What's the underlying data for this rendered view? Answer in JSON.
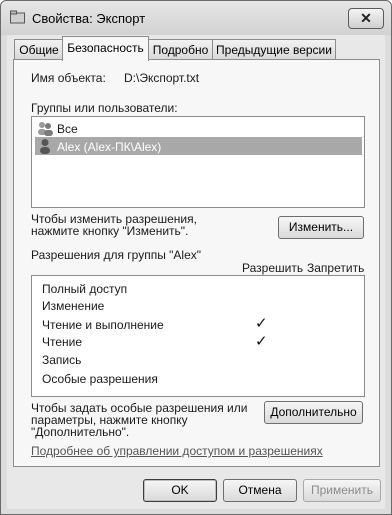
{
  "window": {
    "title": "Свойства: Экспорт",
    "close_glyph": "✕"
  },
  "tabs": [
    {
      "label": "Общие",
      "active": false
    },
    {
      "label": "Безопасность",
      "active": true
    },
    {
      "label": "Подробно",
      "active": false
    },
    {
      "label": "Предыдущие версии",
      "active": false
    }
  ],
  "object": {
    "label": "Имя объекта:",
    "value": "D:\\Экспорт.txt"
  },
  "groups": {
    "label": "Группы или пользователи:",
    "items": [
      {
        "name": "Все",
        "icon": "users-group-icon",
        "selected": false
      },
      {
        "name": "Alex (Alex-ПК\\Alex)",
        "icon": "user-icon",
        "selected": true
      }
    ]
  },
  "change": {
    "hint": "Чтобы изменить разрешения,\nнажмите кнопку \"Изменить\".",
    "button": "Изменить..."
  },
  "permissions": {
    "label": "Разрешения для группы \"Alex\"",
    "allow_header": "Разрешить",
    "deny_header": "Запретить",
    "rows": [
      {
        "name": "Полный доступ",
        "allow": false,
        "deny": false
      },
      {
        "name": "Изменение",
        "allow": false,
        "deny": false
      },
      {
        "name": "Чтение и выполнение",
        "allow": true,
        "deny": false
      },
      {
        "name": "Чтение",
        "allow": true,
        "deny": false
      },
      {
        "name": "Запись",
        "allow": false,
        "deny": false
      },
      {
        "name": "Особые разрешения",
        "allow": false,
        "deny": false
      }
    ],
    "check_glyph": "✓"
  },
  "advanced": {
    "hint": "Чтобы задать особые разрешения или\nпараметры, нажмите кнопку\n\"Дополнительно\".",
    "button": "Дополнительно"
  },
  "link_text": "Подробнее об управлении доступом и разрешениях",
  "footer": {
    "ok": "OK",
    "cancel": "Отмена",
    "apply": "Применить"
  }
}
